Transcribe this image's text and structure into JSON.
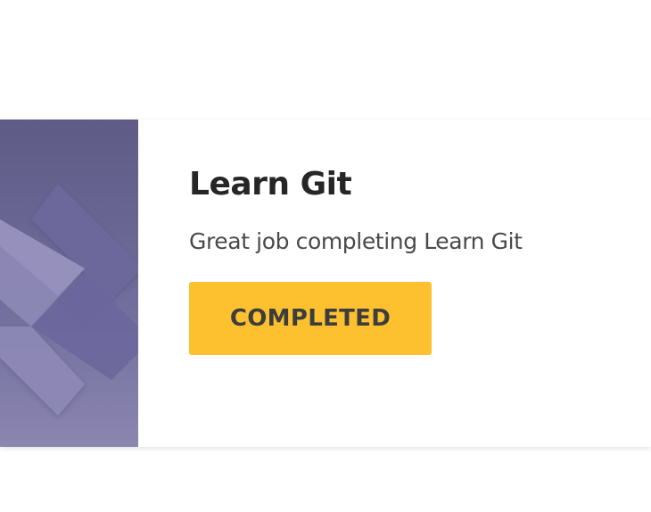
{
  "course": {
    "title": "Learn Git",
    "description": "Great job completing Learn Git",
    "status_label": "COMPLETED",
    "thumbnail_icon": "chevron-pattern-icon"
  },
  "colors": {
    "thumbnail_top": "#5f5b86",
    "thumbnail_bottom": "#8a86b0",
    "chevron_light": "#8e89b6",
    "chevron_dark": "#6c679c",
    "button_background": "#fdc12f",
    "button_text": "#3d3d3d",
    "title_text": "#262626",
    "description_text": "#4a4a4a"
  }
}
